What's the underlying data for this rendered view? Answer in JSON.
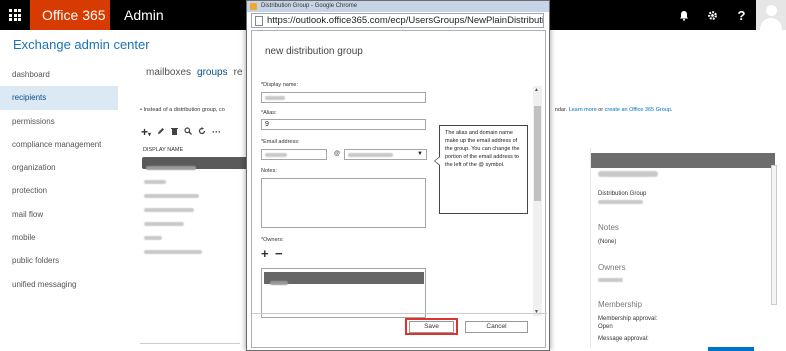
{
  "topbar": {
    "brand": "Office 365",
    "app": "Admin",
    "icons": [
      "waffle-icon",
      "bell-icon",
      "gear-icon",
      "help-icon",
      "user-avatar"
    ],
    "help_label": "?"
  },
  "eac_title": "Exchange admin center",
  "nav": {
    "items": [
      "dashboard",
      "recipients",
      "permissions",
      "compliance management",
      "organization",
      "protection",
      "mail flow",
      "mobile",
      "public folders",
      "unified messaging"
    ],
    "active": "recipients"
  },
  "tabs": [
    "mailboxes",
    "groups",
    "re"
  ],
  "info": {
    "prefix": "• Instead of a distribution group, co",
    "suffix": "ndar.",
    "link1": "Learn more",
    "mid": " or ",
    "link2": "create an Office 365 Group",
    "end": "."
  },
  "list": {
    "column_header": "DISPLAY NAME"
  },
  "detail": {
    "group_type": "Distribution Group",
    "notes_title": "Notes",
    "notes_value": "(None)",
    "owners_title": "Owners",
    "membership_title": "Membership",
    "membership_approval_label": "Membership approval:",
    "membership_approval_value": "Open",
    "message_approval_label": "Message approval:"
  },
  "browser": {
    "window_title": "Distribution Group - Google Chrome",
    "url": "https://outlook.office365.com/ecp/UsersGroups/NewPlainDistributio"
  },
  "dialog": {
    "title": "new distribution group",
    "display_name_label": "*Display name:",
    "alias_label": "*Alias:",
    "alias_value": "9",
    "email_label": "*Email address:",
    "at_symbol": "@",
    "notes_label": "Notes:",
    "tooltip": "The alias and domain name make up the email address of the group. You can change the portion of the email address to the left of the @ symbol.",
    "owners_label": "*Owners:",
    "add_symbol": "+",
    "remove_symbol": "−",
    "save": "Save",
    "cancel": "Cancel"
  },
  "colors": {
    "brand": "#d83b01",
    "accent": "#0072c6",
    "highlight": "#e0322f"
  }
}
